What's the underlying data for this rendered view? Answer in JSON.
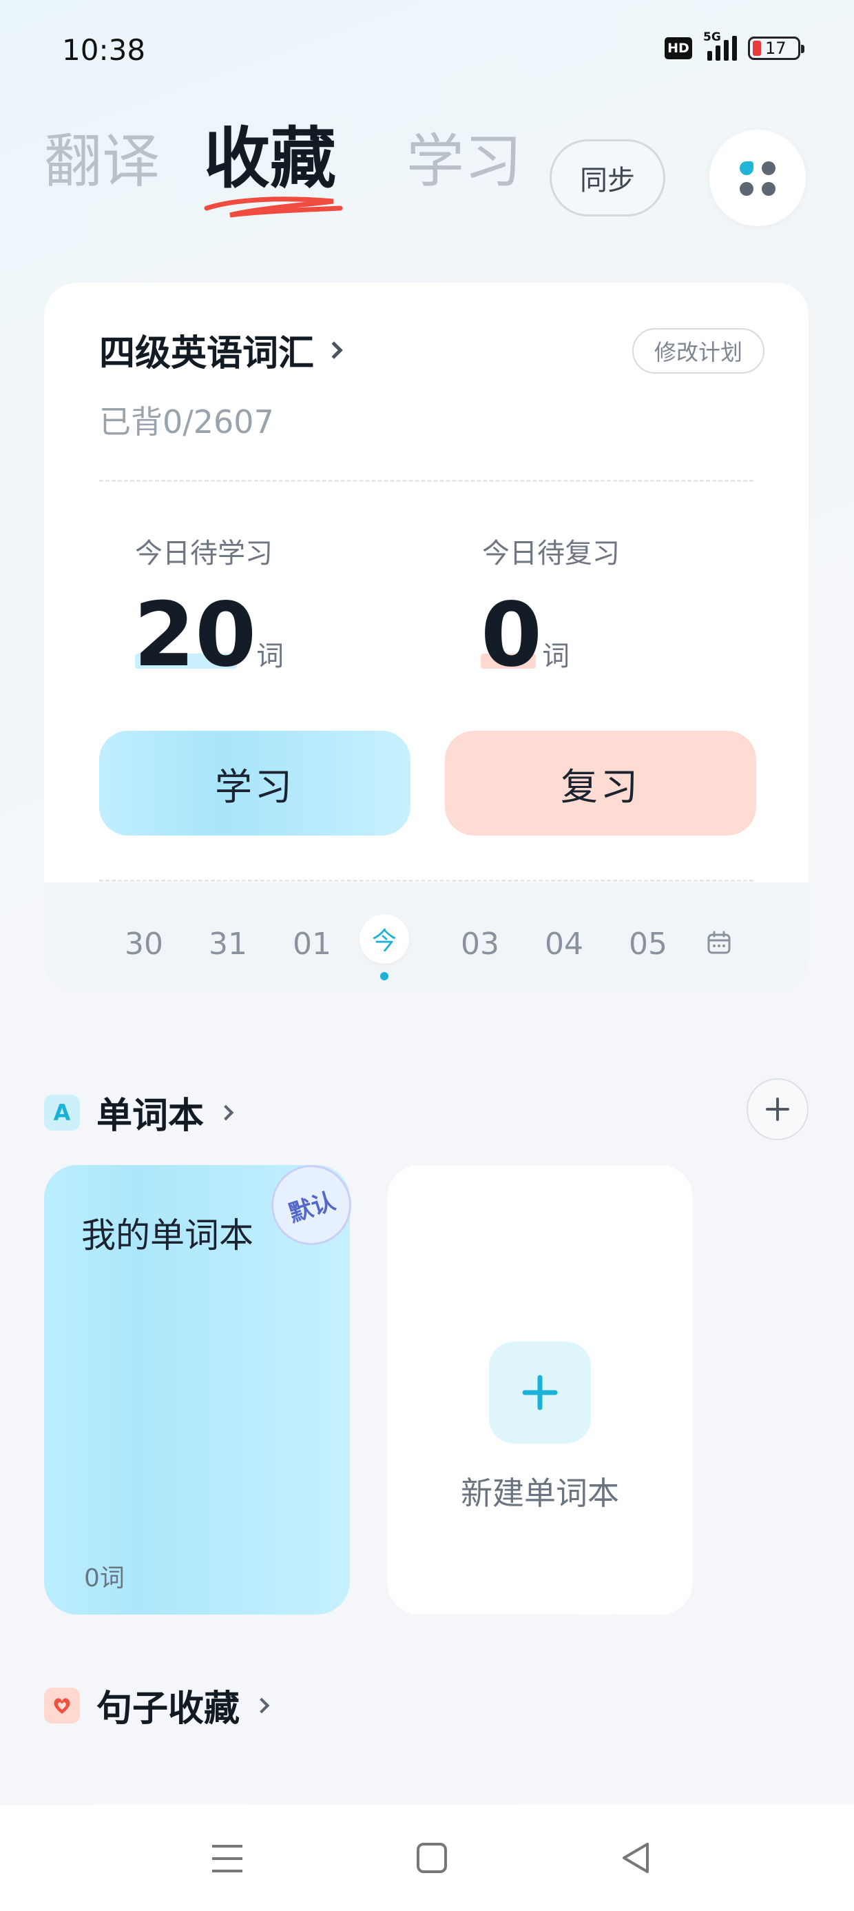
{
  "status_bar": {
    "time": "10:38",
    "hd_label": "HD",
    "network": "5G",
    "battery": "17",
    "battery_color": "#e83a3a"
  },
  "top_tabs": {
    "translate": "翻译",
    "collect": "收藏",
    "learn": "学习",
    "active": "收藏",
    "sync_button": "同步",
    "menu_icon": "apps-grid-icon"
  },
  "plan": {
    "title": "四级英语词汇",
    "modify_button": "修改计划",
    "progress_label": "已背0/2607",
    "today_learn_label": "今日待学习",
    "today_learn_value": "20",
    "today_review_label": "今日待复习",
    "today_review_value": "0",
    "unit": "词",
    "learn_button": "学习",
    "review_button": "复习",
    "dates": [
      "30",
      "31",
      "01",
      "今",
      "03",
      "04",
      "05"
    ],
    "selected_date": "今",
    "calendar_icon": "calendar-icon",
    "accent_learn": "#1cb2d6",
    "accent_review": "#ffdcd3"
  },
  "wordbook": {
    "section_title": "单词本",
    "section_icon_letter": "A",
    "add_button_icon": "plus-icon",
    "books": [
      {
        "name": "我的单词本",
        "count": "0词",
        "badge": "默认"
      }
    ],
    "new_book_label": "新建单词本"
  },
  "sentences": {
    "section_title": "句子收藏",
    "icon": "heart-icon"
  },
  "nav_bar": {
    "menu_icon": "menu-icon",
    "home_icon": "home-square-icon",
    "back_icon": "back-triangle-icon"
  }
}
